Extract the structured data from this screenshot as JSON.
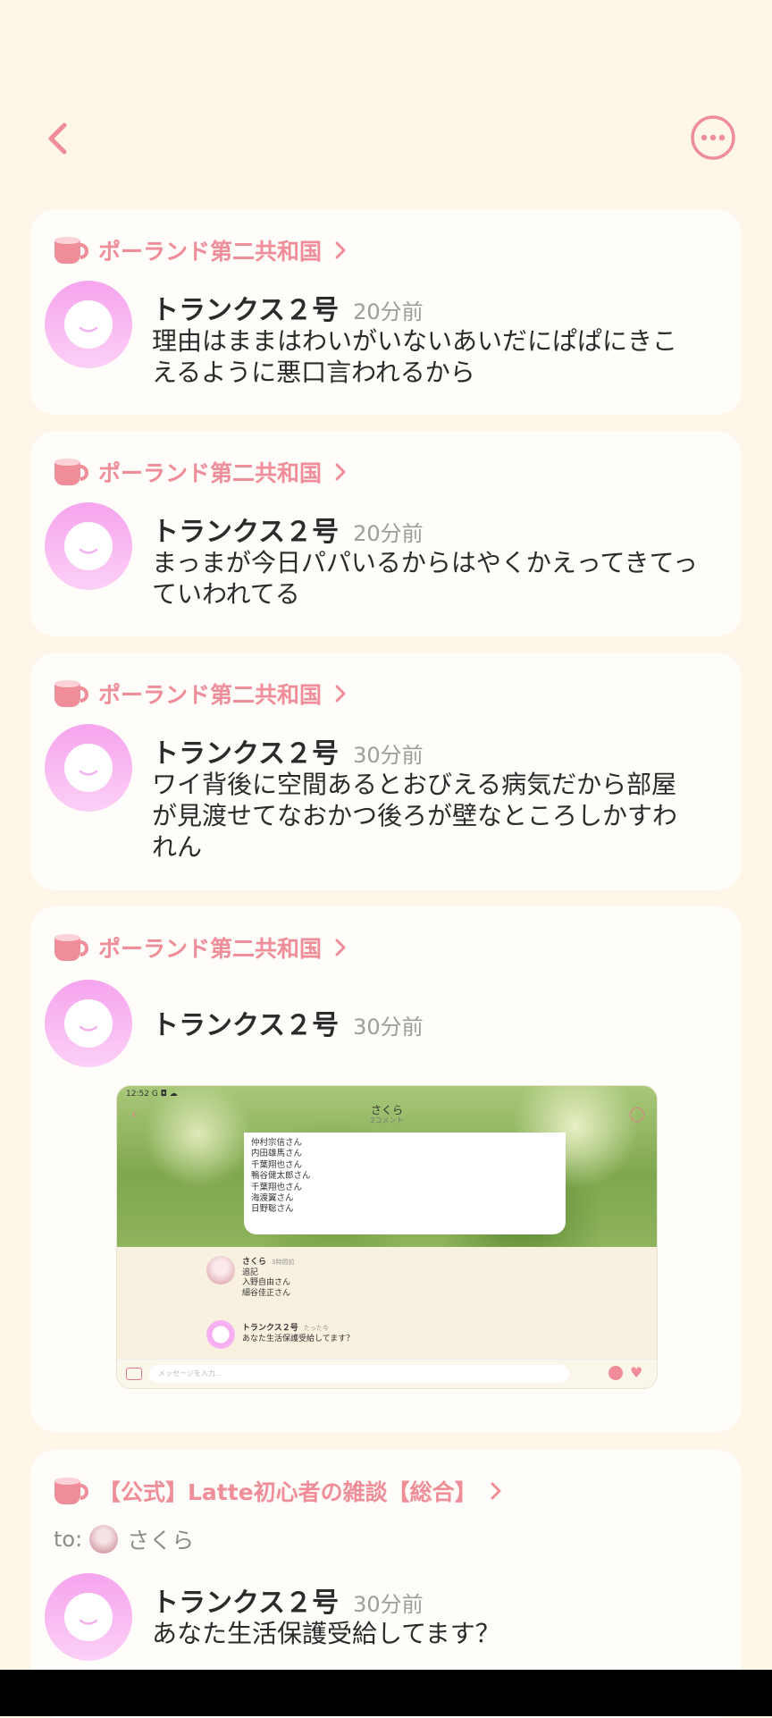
{
  "colors": {
    "accent": "#ef8d98",
    "background": "#fdf6e9",
    "card": "#fffdf9",
    "avatar_pink": "#f7a9ef"
  },
  "header": {
    "back_icon": "chevron-left-icon",
    "more_icon": "more-options-icon"
  },
  "posts": [
    {
      "group": "ポーランド第二共和国",
      "author": "トランクス２号",
      "time": "20分前",
      "lines": [
        "理由はままはわいがいないあいだにぱぱにきこ",
        "えるように悪口言われるから"
      ]
    },
    {
      "group": "ポーランド第二共和国",
      "author": "トランクス２号",
      "time": "20分前",
      "lines": [
        "まっまが今日パパいるからはやくかえってきてっ",
        "ていわれてる"
      ]
    },
    {
      "group": "ポーランド第二共和国",
      "author": "トランクス２号",
      "time": "30分前",
      "lines": [
        "ワイ背後に空間あるとおびえる病気だから部屋",
        "が見渡せてなおかつ後ろが壁なところしかすわ",
        "れん"
      ]
    },
    {
      "group": "ポーランド第二共和国",
      "author": "トランクス２号",
      "time": "30分前",
      "image": {
        "status_time": "12:52",
        "status_icons": "G ◘ ☁",
        "title": "さくら",
        "subtitle": "2コメント",
        "names": [
          "仲村宗信さん",
          "内田雄馬さん",
          "千葉翔也さん",
          "鴨谷健太郎さん",
          "千葉翔也さん",
          "海渡翼さん",
          "日野聡さん"
        ],
        "comment1": {
          "name": "さくら",
          "time": "3時間前",
          "lines": [
            "追記",
            "入野自由さん",
            "細谷佳正さん"
          ]
        },
        "comment2": {
          "name": "トランクス２号",
          "time": "たった今",
          "lines": [
            "あなた生活保護受給してます？"
          ]
        },
        "input_placeholder": "メッセージを入力..."
      }
    },
    {
      "group": "【公式】Latte初心者の雑談【総合】",
      "to_label": "to:",
      "to_name": "さくら",
      "author": "トランクス２号",
      "time": "30分前",
      "lines": [
        "あなた生活保護受給してます？"
      ]
    }
  ]
}
